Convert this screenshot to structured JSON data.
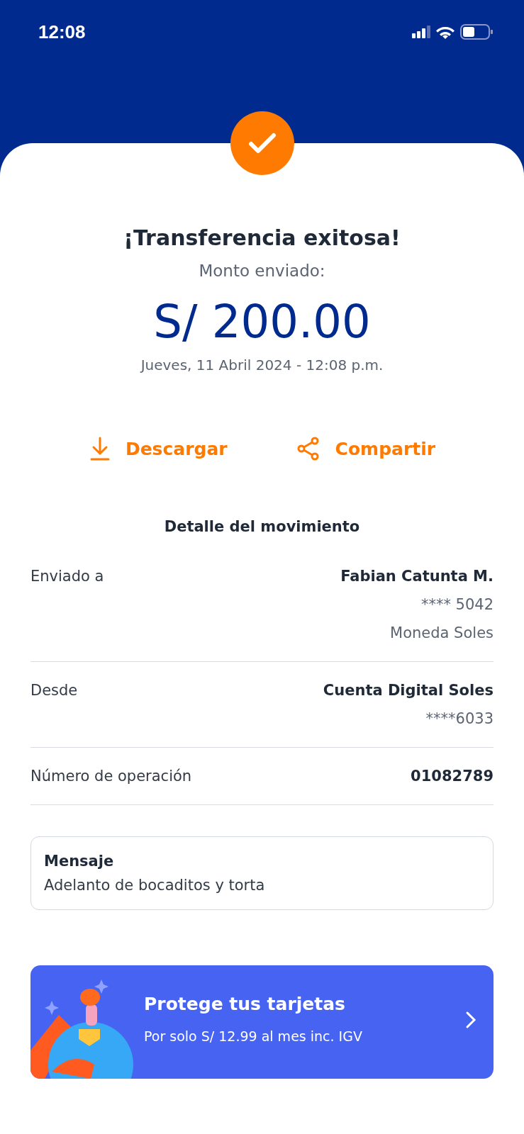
{
  "status_bar": {
    "time": "12:08"
  },
  "result": {
    "title": "¡Transferencia exitosa!",
    "amount_label": "Monto enviado:",
    "amount": "S/ 200.00",
    "date": "Jueves, 11 Abril 2024 - 12:08 p.m."
  },
  "actions": [
    {
      "kind": "download",
      "label": "Descargar"
    },
    {
      "kind": "share",
      "label": "Compartir"
    }
  ],
  "detail": {
    "title": "Detalle del movimiento",
    "rows": [
      {
        "label": "Enviado a",
        "values": [
          "Fabian Catunta M.",
          "**** 5042",
          "Moneda Soles"
        ]
      },
      {
        "label": "Desde",
        "values": [
          "Cuenta Digital Soles",
          "****6033"
        ]
      },
      {
        "label": "Número de operación",
        "values": [
          "01082789"
        ]
      }
    ]
  },
  "message": {
    "title": "Mensaje",
    "text": "Adelanto de bocaditos y torta"
  },
  "promo": {
    "title": "Protege tus tarjetas",
    "subtitle": "Por solo S/ 12.99 al mes inc. IGV"
  }
}
